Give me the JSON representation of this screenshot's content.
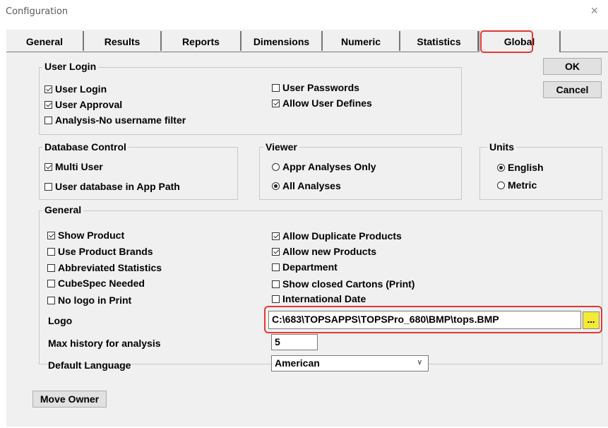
{
  "window": {
    "title": "Configuration",
    "close_glyph": "×"
  },
  "tabs": [
    "General",
    "Results",
    "Reports",
    "Dimensions",
    "Numeric",
    "Statistics",
    "Global"
  ],
  "active_tab": "Global",
  "buttons": {
    "ok": "OK",
    "cancel": "Cancel",
    "move_owner": "Move Owner",
    "browse": "..."
  },
  "user_login": {
    "label": "User Login",
    "items": [
      {
        "label": "User Login",
        "checked": true
      },
      {
        "label": "User Approval",
        "checked": true
      },
      {
        "label": "Analysis-No username filter",
        "checked": false
      },
      {
        "label": "User Passwords",
        "checked": false
      },
      {
        "label": "Allow User Defines",
        "checked": true
      }
    ]
  },
  "database_control": {
    "label": "Database Control",
    "items": [
      {
        "label": "Multi User",
        "checked": true
      },
      {
        "label": "User database in App Path",
        "checked": false
      }
    ]
  },
  "viewer": {
    "label": "Viewer",
    "options": [
      {
        "label": "Appr Analyses Only",
        "selected": false
      },
      {
        "label": "All Analyses",
        "selected": true
      }
    ]
  },
  "units": {
    "label": "Units",
    "options": [
      {
        "label": "English",
        "selected": true
      },
      {
        "label": "Metric",
        "selected": false
      }
    ]
  },
  "general": {
    "label": "General",
    "left_items": [
      {
        "label": "Show Product",
        "checked": true
      },
      {
        "label": "Use Product Brands",
        "checked": false
      },
      {
        "label": "Abbreviated Statistics",
        "checked": false
      },
      {
        "label": "CubeSpec Needed",
        "checked": false
      },
      {
        "label": "No logo in Print",
        "checked": false
      }
    ],
    "right_items": [
      {
        "label": "Allow Duplicate Products",
        "checked": true
      },
      {
        "label": "Allow new Products",
        "checked": true
      },
      {
        "label": "Department",
        "checked": false
      },
      {
        "label": "Show closed Cartons (Print)",
        "checked": false
      },
      {
        "label": "International Date",
        "checked": false
      }
    ],
    "logo_label": "Logo",
    "logo_value": "C:\\683\\TOPSAPPS\\TOPSPro_680\\BMP\\tops.BMP",
    "max_history_label": "Max history for analysis",
    "max_history_value": "5",
    "default_language_label": "Default Language",
    "default_language_value": "American"
  }
}
